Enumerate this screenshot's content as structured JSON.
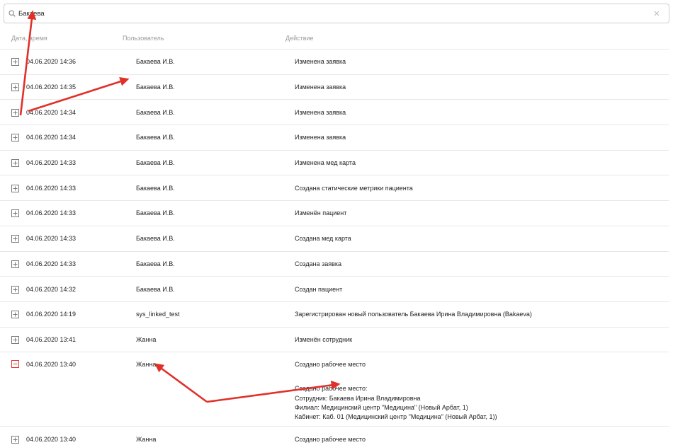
{
  "search": {
    "value": "Бакаева",
    "placeholder": ""
  },
  "columns": {
    "date": "Дата, время",
    "user": "Пользователь",
    "action": "Действие"
  },
  "rows": [
    {
      "date": "04.06.2020 14:36",
      "user": "Бакаева И.В.",
      "action": "Изменена заявка",
      "expanded": false
    },
    {
      "date": "04.06.2020 14:35",
      "user": "Бакаева И.В.",
      "action": "Изменена заявка",
      "expanded": false
    },
    {
      "date": "04.06.2020 14:34",
      "user": "Бакаева И.В.",
      "action": "Изменена заявка",
      "expanded": false
    },
    {
      "date": "04.06.2020 14:34",
      "user": "Бакаева И.В.",
      "action": "Изменена заявка",
      "expanded": false
    },
    {
      "date": "04.06.2020 14:33",
      "user": "Бакаева И.В.",
      "action": "Изменена мед карта",
      "expanded": false
    },
    {
      "date": "04.06.2020 14:33",
      "user": "Бакаева И.В.",
      "action": "Создана статические метрики пациента",
      "expanded": false
    },
    {
      "date": "04.06.2020 14:33",
      "user": "Бакаева И.В.",
      "action": "Изменён пациент",
      "expanded": false
    },
    {
      "date": "04.06.2020 14:33",
      "user": "Бакаева И.В.",
      "action": "Создана мед карта",
      "expanded": false
    },
    {
      "date": "04.06.2020 14:33",
      "user": "Бакаева И.В.",
      "action": "Создана заявка",
      "expanded": false
    },
    {
      "date": "04.06.2020 14:32",
      "user": "Бакаева И.В.",
      "action": "Создан пациент",
      "expanded": false
    },
    {
      "date": "04.06.2020 14:19",
      "user": "sys_linked_test",
      "action": "Зарегистрирован новый пользователь Бакаева Ирина Владимировна (Bakaeva)",
      "expanded": false
    },
    {
      "date": "04.06.2020 13:41",
      "user": "Жанна",
      "action": "Изменён сотрудник",
      "expanded": false
    },
    {
      "date": "04.06.2020 13:40",
      "user": "Жанна",
      "action": "Создано рабочее место",
      "expanded": true,
      "details": [
        "Создано рабочее место:",
        "Сотрудник: Бакаева Ирина Владимировна",
        "Филиал: Медицинский центр \"Медицина\" (Новый Арбат, 1)",
        "Кабинет: Каб. 01 (Медицинский центр \"Медицина\" (Новый Арбат, 1))"
      ]
    },
    {
      "date": "04.06.2020 13:40",
      "user": "Жанна",
      "action": "Создано рабочее место",
      "expanded": false
    }
  ],
  "colors": {
    "expand_icon": "#7a7a7a",
    "collapse_icon": "#e53935",
    "annotation_arrow": "#e0302a"
  },
  "icons": {
    "search": "search-icon",
    "clear": "close-icon",
    "expand": "plus-square-icon",
    "collapse": "minus-square-icon"
  }
}
